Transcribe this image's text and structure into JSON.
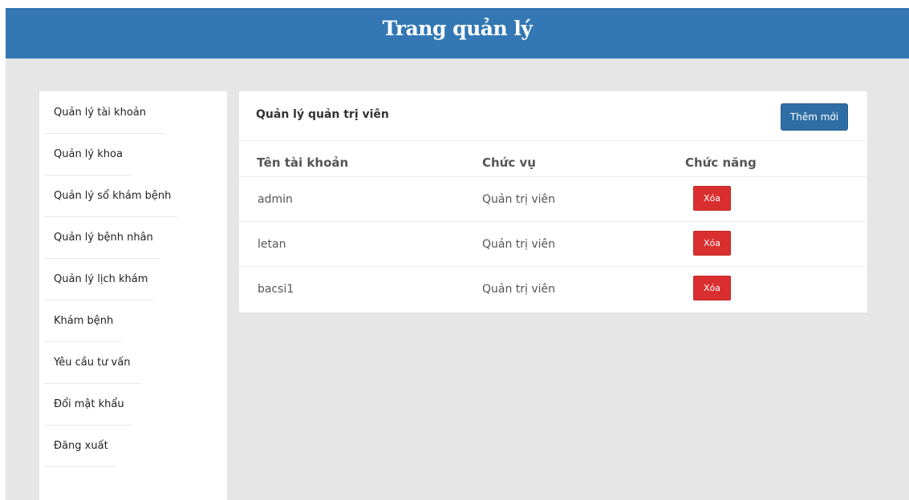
{
  "header": {
    "title": "Trang quản lý"
  },
  "sidebar": {
    "items": [
      {
        "label": "Quản lý tài khoản"
      },
      {
        "label": "Quản lý khoa"
      },
      {
        "label": "Quản lý sổ khám bệnh"
      },
      {
        "label": "Quản lý bệnh nhân"
      },
      {
        "label": "Quản lý lịch khám"
      },
      {
        "label": "Khám bệnh"
      },
      {
        "label": "Yêu cầu tư vấn"
      },
      {
        "label": "Đổi mật khẩu"
      },
      {
        "label": "Đăng xuất"
      }
    ]
  },
  "panel": {
    "title": "Quản lý quản trị viên",
    "add_label": "Thêm mới",
    "columns": [
      "Tên tài khoản",
      "Chức vụ",
      "Chức năng"
    ],
    "rows": [
      {
        "username": "admin",
        "role": "Quản trị viên",
        "action": "Xóa"
      },
      {
        "username": "letan",
        "role": "Quản trị viên",
        "action": "Xóa"
      },
      {
        "username": "bacsi1",
        "role": "Quản trị viên",
        "action": "Xóa"
      }
    ]
  },
  "colors": {
    "header_bg": "#3378b4",
    "primary_button": "#2f6ea5",
    "danger_button": "#d9302f",
    "page_bg": "#e6e6e6"
  }
}
